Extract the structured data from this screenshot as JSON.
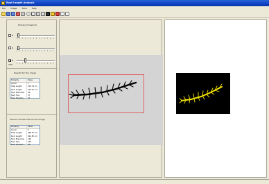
{
  "window": {
    "title": "Root Length Analysis"
  },
  "menu": [
    "File",
    "Image",
    "Tools",
    "Help"
  ],
  "toolbar": {
    "buttons": [
      "open-icon",
      "save-icon",
      "save-as-icon",
      "export-icon",
      "print-icon",
      "zoom-icon",
      "select-icon",
      "crop-icon",
      "move-icon",
      "threshold-icon",
      "measure-icon",
      "stop-icon",
      "copy-icon",
      "paste-icon"
    ]
  },
  "threshold": {
    "title": "Primary threshold",
    "options": [
      {
        "label": "R",
        "checked": false
      },
      {
        "label": "G",
        "checked": false
      },
      {
        "label": "B",
        "checked": true
      }
    ],
    "value_label": "100"
  },
  "results": {
    "title": "Results for the image",
    "header": [
      "Property",
      "Value"
    ],
    "rows": [
      [
        "Count",
        "1"
      ],
      [
        "Total Length",
        "104.79 cm"
      ],
      [
        "Root Length",
        "104.07 cm"
      ],
      [
        "Num Branches",
        "36"
      ],
      [
        "Num Tips",
        "37"
      ],
      [
        "Num Dividers",
        "27"
      ]
    ]
  },
  "session": {
    "title": "Session results without the image",
    "header": [
      "Property",
      "Value"
    ],
    "rows": [
      [
        "Count",
        "5"
      ],
      [
        "Total Length",
        "268.75 cm"
      ],
      [
        "Root Length",
        "262.85 cm"
      ],
      [
        "Num Branches",
        "106"
      ],
      [
        "Num Tips",
        "108"
      ],
      [
        "Num Dividers",
        "76"
      ]
    ]
  },
  "colors": {
    "accent": "#0f43c4",
    "roi": "#e06060",
    "root_fill": "#000000",
    "overlay": "#f2e200"
  }
}
